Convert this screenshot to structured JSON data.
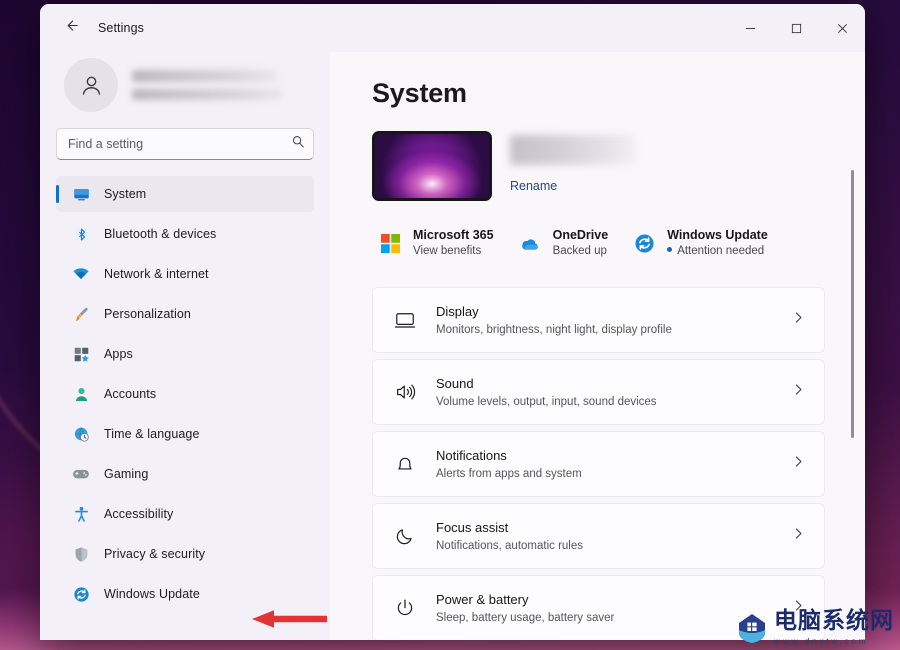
{
  "window": {
    "title": "Settings",
    "back_icon": "back-arrow-icon",
    "minimize_label": "─",
    "maximize_label": "□",
    "close_label": "✕"
  },
  "sidebar": {
    "account": {
      "avatar_icon": "person-avatar-icon",
      "name_redacted": "",
      "email_redacted": ""
    },
    "search": {
      "placeholder": "Find a setting",
      "value": "",
      "icon": "search-icon"
    },
    "items": [
      {
        "label": "System",
        "icon": "monitor-icon",
        "selected": true
      },
      {
        "label": "Bluetooth & devices",
        "icon": "bluetooth-icon",
        "selected": false
      },
      {
        "label": "Network & internet",
        "icon": "wifi-icon",
        "selected": false
      },
      {
        "label": "Personalization",
        "icon": "paintbrush-icon",
        "selected": false
      },
      {
        "label": "Apps",
        "icon": "apps-grid-icon",
        "selected": false
      },
      {
        "label": "Accounts",
        "icon": "account-person-icon",
        "selected": false
      },
      {
        "label": "Time & language",
        "icon": "clock-globe-icon",
        "selected": false
      },
      {
        "label": "Gaming",
        "icon": "gamepad-icon",
        "selected": false
      },
      {
        "label": "Accessibility",
        "icon": "accessibility-icon",
        "selected": false
      },
      {
        "label": "Privacy & security",
        "icon": "shield-icon",
        "selected": false
      },
      {
        "label": "Windows Update",
        "icon": "windows-update-icon",
        "selected": false
      }
    ]
  },
  "main": {
    "page_title": "System",
    "device": {
      "thumbnail_icon": "device-wallpaper-thumbnail",
      "name_redacted": "",
      "rename_label": "Rename"
    },
    "status_cards": [
      {
        "title": "Microsoft 365",
        "subtitle": "View benefits",
        "icon": "microsoft-365-icon",
        "has_dot": false
      },
      {
        "title": "OneDrive",
        "subtitle": "Backed up",
        "icon": "onedrive-icon",
        "has_dot": false
      },
      {
        "title": "Windows Update",
        "subtitle": "Attention needed",
        "icon": "windows-update-icon",
        "has_dot": true
      }
    ],
    "rows": [
      {
        "title": "Display",
        "subtitle": "Monitors, brightness, night light, display profile",
        "icon": "display-monitor-icon",
        "chevron": "chevron-right-icon"
      },
      {
        "title": "Sound",
        "subtitle": "Volume levels, output, input, sound devices",
        "icon": "speaker-sound-icon",
        "chevron": "chevron-right-icon"
      },
      {
        "title": "Notifications",
        "subtitle": "Alerts from apps and system",
        "icon": "bell-icon",
        "chevron": "chevron-right-icon"
      },
      {
        "title": "Focus assist",
        "subtitle": "Notifications, automatic rules",
        "icon": "moon-icon",
        "chevron": "chevron-right-icon"
      },
      {
        "title": "Power & battery",
        "subtitle": "Sleep, battery usage, battery saver",
        "icon": "power-icon",
        "chevron": "chevron-right-icon"
      }
    ]
  },
  "annotation": {
    "arrow_icon": "red-left-arrow-annotation",
    "arrow_color": "#e23434",
    "points_at": "Windows Update"
  },
  "watermark": {
    "site_name": "电脑系统网",
    "url": "www.dnxtw.com",
    "badge_icon": "house-shield-logo-icon"
  },
  "colors": {
    "accent": "#0c6fd0",
    "window_bg": "#f3f0f7",
    "content_bg": "#faf7fb",
    "card_bg": "#fdfcfe",
    "link": "#23497e"
  }
}
